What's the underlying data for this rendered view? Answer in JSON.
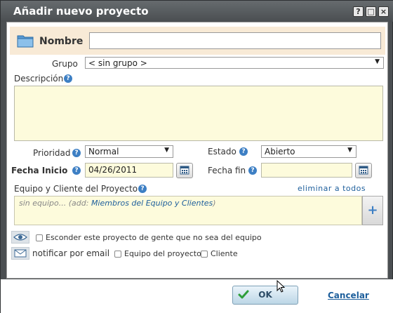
{
  "dialog": {
    "title": "Añadir nuevo proyecto",
    "buttons": {
      "help": "?",
      "maximize": "□",
      "close": "×"
    }
  },
  "form": {
    "nombre_label": "Nombre",
    "nombre_value": "",
    "grupo_label": "Grupo",
    "grupo_value": "< sin grupo >",
    "descripcion_label": "Descripción",
    "descripcion_value": "",
    "prioridad_label": "Prioridad",
    "prioridad_value": "Normal",
    "estado_label": "Estado",
    "estado_value": "Abierto",
    "fecha_inicio_label": "Fecha Inicio",
    "fecha_inicio_value": "04/26/2011",
    "fecha_fin_label": "Fecha fin",
    "fecha_fin_value": "",
    "team_label": "Equipo y Cliente del Proyecto",
    "remove_all": "eliminar a todos",
    "team_placeholder_prefix": "sin equipo... (add: ",
    "team_placeholder_link": "Miembros del Equipo y Clientes",
    "team_placeholder_suffix": ")",
    "add_button": "+",
    "hide_label": "Esconder este proyecto de gente que no sea del equipo",
    "notify_label": "notificar por email",
    "notify_team": "Equipo del proyecto",
    "notify_client": "Cliente"
  },
  "footer": {
    "ok": "OK",
    "cancel": "Cancelar"
  },
  "icons": {
    "folder": "folder-icon",
    "help": "help-icon",
    "calendar": "calendar-icon",
    "eye": "eye-icon",
    "mail": "mail-icon",
    "check": "check-icon"
  },
  "colors": {
    "accent": "#3d7fc4",
    "link": "#1e5f9c",
    "field_yellow": "#fdfbdc",
    "name_band": "#f8ead6",
    "titlebar": "#55595c"
  }
}
